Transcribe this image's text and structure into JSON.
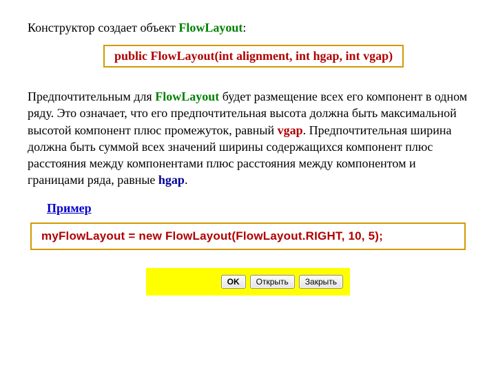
{
  "intro": {
    "prefix": "Конструктор создает объект ",
    "classname": "FlowLayout",
    "suffix": ":"
  },
  "signature": {
    "text": "public FlowLayout(int alignment, int hgap, int vgap)"
  },
  "paragraph": {
    "t1": "Предпочтительным для ",
    "flow": "FlowLayout",
    "t2": " будет размещение всех его компонент в одном ряду. Это означает, что его предпочтительная высота должна быть максимальной высотой компонент плюс промежуток, равный ",
    "vgap": "vgap",
    "t3": ". Предпочтительная ширина должна быть суммой всех значений ширины содержащихся компонент плюс расстояния  между компонентами плюс расстояния между компонентом и границами ряда, равные ",
    "hgap": "hgap",
    "t4": "."
  },
  "example_label": "Пример",
  "code": "myFlowLayout = new FlowLayout(FlowLayout.RIGHT, 10, 5);",
  "buttons": {
    "ok": "OK",
    "open": "Открыть",
    "close": "Закрыть"
  }
}
